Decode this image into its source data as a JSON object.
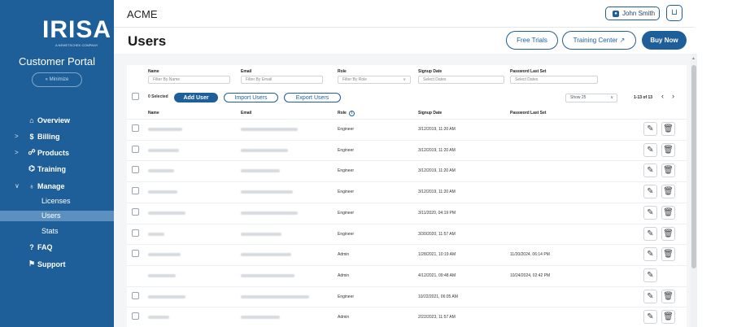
{
  "sidebar": {
    "logo": "IRISA",
    "logo_sub": "A NEMETSCHEK COMPANY",
    "portal_title": "Customer Portal",
    "minimize": "« Minimize",
    "nav": [
      {
        "label": "Overview",
        "icon": "home-icon",
        "glyph": "⌂",
        "chevron": ""
      },
      {
        "label": "Billing",
        "icon": "billing-icon",
        "glyph": "$",
        "chevron": ">"
      },
      {
        "label": "Products",
        "icon": "products-icon",
        "glyph": "☍",
        "chevron": ">"
      },
      {
        "label": "Training",
        "icon": "training-icon",
        "glyph": "⌬",
        "chevron": ""
      },
      {
        "label": "Manage",
        "icon": "manage-icon",
        "glyph": "♁",
        "chevron": "∨"
      }
    ],
    "manage_sub": [
      "Licenses",
      "Users",
      "Stats"
    ],
    "nav_bottom": [
      {
        "label": "FAQ",
        "glyph": "?"
      },
      {
        "label": "Support",
        "glyph": "⚑"
      }
    ]
  },
  "topbar": {
    "company": "ACME",
    "user_name": "John Smith"
  },
  "header": {
    "title": "Users",
    "free_trials": "Free Trials",
    "training_center": "Training Center ↗",
    "buy_now": "Buy Now"
  },
  "filters": {
    "name_label": "Name",
    "name_placeholder": "Filter By Name",
    "email_label": "Email",
    "email_placeholder": "Filter By Email",
    "role_label": "Role",
    "role_placeholder": "Filter By Role",
    "signup_label": "Signup Date",
    "signup_placeholder": "Select Dates",
    "password_label": "Password Last Set",
    "password_placeholder": "Select Dates"
  },
  "toolbar": {
    "selected": "0 Selected",
    "add_user": "Add User",
    "import_users": "Import Users",
    "export_users": "Export Users",
    "show": "Show 25",
    "range": "1-13 of 13"
  },
  "columns": [
    "Name",
    "Email",
    "Role",
    "Signup Date",
    "Password Last Set"
  ],
  "rows": [
    {
      "role": "Engineer",
      "signup": "3/12/2019, 11:20 AM",
      "password": "",
      "checkbox": true,
      "delete": true
    },
    {
      "role": "Engineer",
      "signup": "3/12/2019, 11:20 AM",
      "password": "",
      "checkbox": true,
      "delete": true
    },
    {
      "role": "Engineer",
      "signup": "3/12/2019, 11:20 AM",
      "password": "",
      "checkbox": true,
      "delete": true
    },
    {
      "role": "Engineer",
      "signup": "3/12/2019, 11:20 AM",
      "password": "",
      "checkbox": true,
      "delete": true
    },
    {
      "role": "Engineer",
      "signup": "3/11/2020, 04:19 PM",
      "password": "",
      "checkbox": true,
      "delete": true
    },
    {
      "role": "Engineer",
      "signup": "3/30/2020, 11:57 AM",
      "password": "",
      "checkbox": true,
      "delete": true
    },
    {
      "role": "Admin",
      "signup": "1/28/2021, 10:19 AM",
      "password": "11/20/2024, 06:14 PM",
      "checkbox": true,
      "delete": true
    },
    {
      "role": "Admin",
      "signup": "4/12/2021, 09:48 AM",
      "password": "10/24/2024, 02:42 PM",
      "checkbox": false,
      "delete": false
    },
    {
      "role": "Engineer",
      "signup": "10/22/2021, 06:05 AM",
      "password": "",
      "checkbox": true,
      "delete": true
    },
    {
      "role": "Admin",
      "signup": "2/22/2023, 11:57 AM",
      "password": "",
      "checkbox": true,
      "delete": true
    }
  ],
  "colors": {
    "brand": "#1f5f99",
    "active_nav": "#5d8fbf"
  }
}
